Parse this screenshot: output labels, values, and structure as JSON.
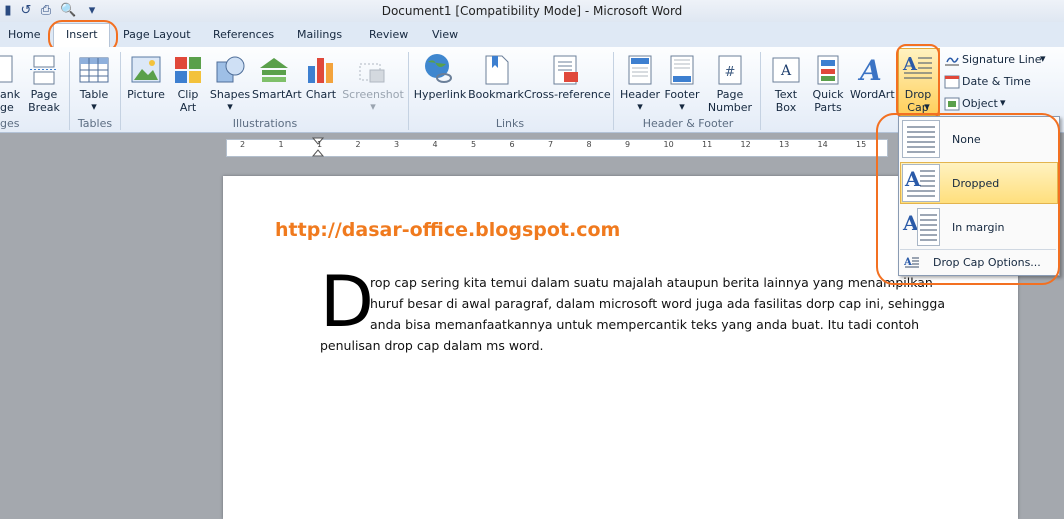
{
  "window": {
    "title": "Document1 [Compatibility Mode] - Microsoft Word"
  },
  "tabs": [
    "Home",
    "Insert",
    "Page Layout",
    "References",
    "Mailings",
    "Review",
    "View"
  ],
  "ribbon": {
    "pages": {
      "blank_page": "ank\nge",
      "page_break": "Page\nBreak",
      "label": "ges"
    },
    "tables": {
      "table": "Table",
      "label": "Tables"
    },
    "illustrations": {
      "picture": "Picture",
      "clip_art": "Clip\nArt",
      "shapes": "Shapes",
      "smartart": "SmartArt",
      "chart": "Chart",
      "screenshot": "Screenshot",
      "label": "Illustrations"
    },
    "links": {
      "hyperlink": "Hyperlink",
      "bookmark": "Bookmark",
      "cross_reference": "Cross-reference",
      "label": "Links"
    },
    "header_footer": {
      "header": "Header",
      "footer": "Footer",
      "page_number": "Page\nNumber",
      "label": "Header & Footer"
    },
    "text": {
      "text_box": "Text\nBox",
      "quick_parts": "Quick\nParts",
      "wordart": "WordArt",
      "drop_cap": "Drop\nCap",
      "signature_line": "Signature Line",
      "date_time": "Date & Time",
      "object": "Object"
    }
  },
  "ruler": {
    "numbers": [
      "2",
      "1",
      "1",
      "2",
      "3",
      "4",
      "5",
      "6",
      "7",
      "8",
      "9",
      "10",
      "11",
      "12",
      "13",
      "14",
      "15"
    ]
  },
  "document": {
    "url": "http://dasar-office.blogspot.com",
    "drop_letter": "D",
    "lines": [
      "rop cap sering kita temui dalam suatu majalah ataupun berita lainnya yang menampilkan",
      "huruf besar di awal paragraf, dalam microsoft word juga ada fasilitas dorp cap ini, sehingga",
      "anda bisa memanfaatkannya untuk mempercantik teks yang anda buat. Itu tadi contoh",
      "penulisan drop cap dalam ms word."
    ]
  },
  "dropdown": {
    "none": "None",
    "dropped": "Dropped",
    "in_margin": "In margin",
    "options": "Drop Cap Options..."
  },
  "colors": {
    "accent": "#f37021",
    "url": "#f07a1e",
    "highlight": "#ffdf7d"
  }
}
